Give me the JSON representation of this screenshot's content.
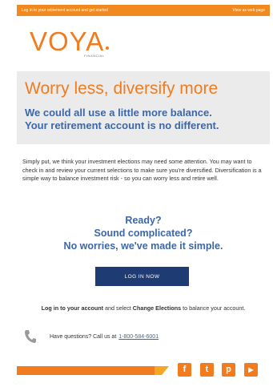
{
  "topbar": {
    "left_text": "Log in to your retirement account and get started",
    "right_text": "View as web page"
  },
  "logo": {
    "word": "VOYA",
    "sub": "FINANCIAL"
  },
  "hero": {
    "title": "Worry less, diversify more",
    "subtitle_line1": "We could all use a little more balance.",
    "subtitle_line2": "Your retirement account is no different."
  },
  "body": {
    "paragraph": "Simply put, we think your investment elections may need some attention. You may want to check in and review your current selections to make sure you're diversified. Diversification is a simple way to balance investment risk - so you can worry less and retire well."
  },
  "qa": {
    "line1": "Ready?",
    "line2": "Sound complicated?",
    "line3": "No worries, we've made it simple."
  },
  "cta": {
    "label": "LOG IN NOW"
  },
  "login_line": {
    "part1": "Log in to your account",
    "part2": " and select ",
    "part3": "Change Elections",
    "part4": " to balance your account."
  },
  "contact": {
    "prefix": "Have questions? Call us at",
    "phone": "1-800-584-6001"
  },
  "social": {
    "facebook": "f",
    "twitter": "t",
    "pinterest": "p",
    "youtube": "▶"
  },
  "colors": {
    "brand_orange": "#f07c1f",
    "brand_blue": "#3c67a8",
    "button_navy": "#1f3b73"
  }
}
